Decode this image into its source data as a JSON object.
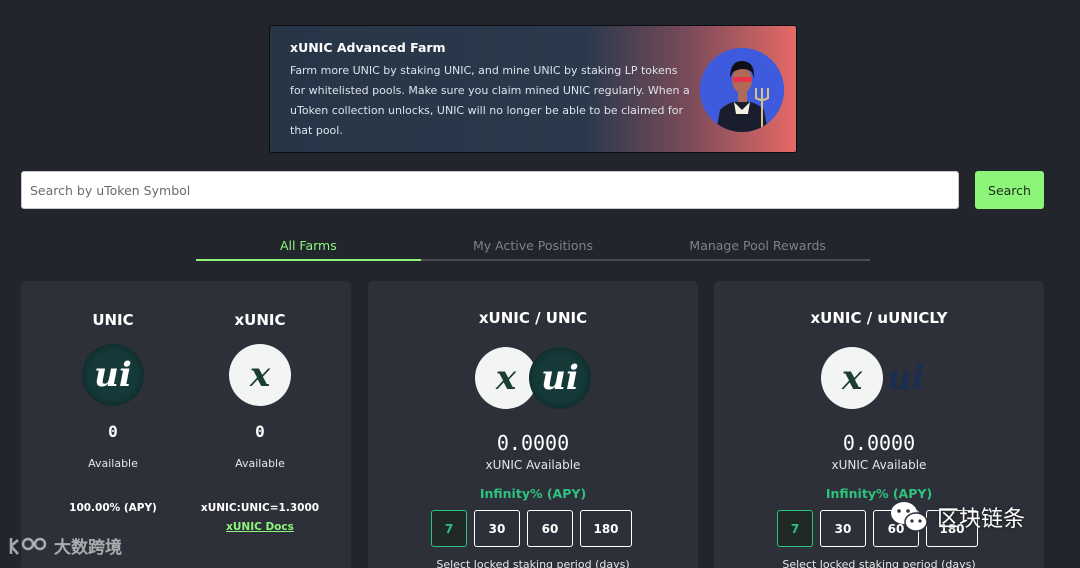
{
  "banner": {
    "title": "xUNIC Advanced Farm",
    "text": "Farm more UNIC by staking UNIC, and mine UNIC by staking LP tokens for whitelisted pools. Make sure you claim mined UNIC regularly. When a uToken collection unlocks, UNIC will no longer be able to be claimed for that pool."
  },
  "search": {
    "placeholder": "Search by uToken Symbol",
    "button_label": "Search"
  },
  "tabs": [
    {
      "label": "All Farms",
      "active": true
    },
    {
      "label": "My Active Positions",
      "active": false
    },
    {
      "label": "Manage Pool Rewards",
      "active": false
    }
  ],
  "staking_card": {
    "columns": [
      {
        "title": "UNIC",
        "icon": "unic-coin-icon",
        "amount": "0",
        "available_label": "Available",
        "apy": "100.00% (APY)"
      },
      {
        "title": "xUNIC",
        "icon": "xunic-coin-icon",
        "amount": "0",
        "available_label": "Available",
        "ratio": "xUNIC:UNIC=1.3000",
        "docs_link": "xUNIC Docs"
      }
    ]
  },
  "pools": [
    {
      "title": "xUNIC / UNIC",
      "amount": "0.0000",
      "available_label": "xUNIC Available",
      "apy": "Infinity% (APY)",
      "periods": [
        "7",
        "30",
        "60",
        "180"
      ],
      "selected_period": "7",
      "caption": "Select locked staking period (days)"
    },
    {
      "title": "xUNIC / uUNICLY",
      "amount": "0.0000",
      "available_label": "xUNIC Available",
      "apy": "Infinity% (APY)",
      "periods": [
        "7",
        "30",
        "60",
        "180"
      ],
      "selected_period": "7",
      "caption": "Select locked staking period (days)"
    }
  ],
  "coin_glyphs": {
    "unic": "ui",
    "xunic": "x"
  },
  "watermarks": {
    "left": "大数跨境",
    "right": "区块链条",
    "left_icon": "kiwi-logo-icon",
    "right_icon": "wechat-icon"
  },
  "colors": {
    "accent_green": "#8cf57a",
    "apy_green": "#2ec27e",
    "background": "#22252c",
    "card": "#2d3038"
  }
}
